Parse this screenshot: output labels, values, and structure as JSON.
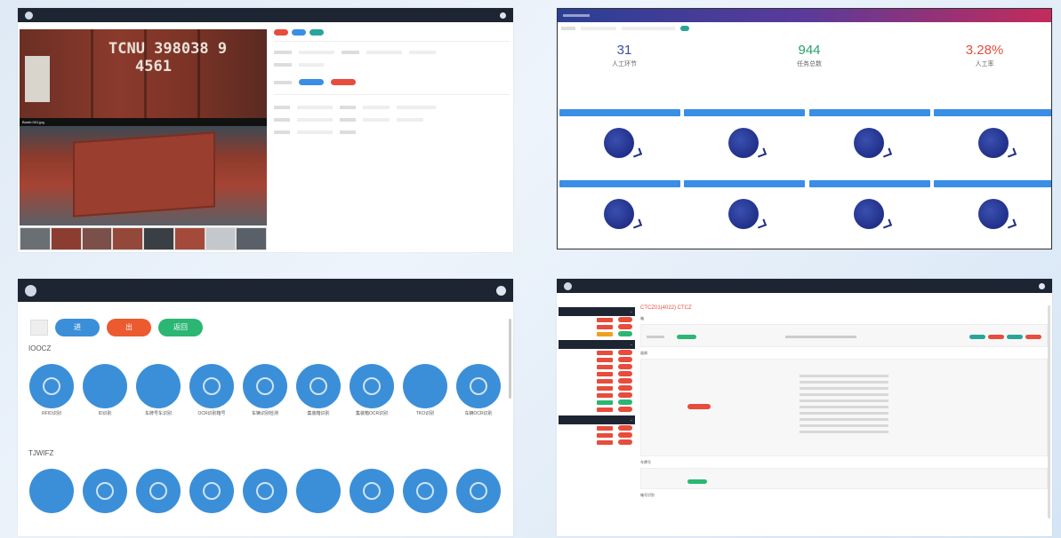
{
  "panel1": {
    "caption": "Bomb 001.jpg",
    "container_code": "TCNU 398038 9",
    "container_code2": "4561",
    "action_buttons": [
      "",
      "",
      ""
    ],
    "thumbs": [
      "#6a6f74",
      "#8a3d30",
      "#7a5048",
      "#93483a",
      "#3a3f45",
      "#a34a3a",
      "#c4c8cc",
      "#5a6068"
    ]
  },
  "panel2": {
    "stats": [
      {
        "value": "31",
        "label": "人工环节",
        "color": "#3b4aa8"
      },
      {
        "value": "944",
        "label": "任务总数",
        "color": "#2aa06a"
      },
      {
        "value": "3.28%",
        "label": "人工率",
        "color": "#e74c3c"
      }
    ]
  },
  "panel3": {
    "tabs": [
      {
        "label": "进",
        "color": "#3b8fd8"
      },
      {
        "label": "出",
        "color": "#ec5a30"
      },
      {
        "label": "返回",
        "color": "#2bb673"
      }
    ],
    "section1": "IOOCZ",
    "section2": "TJWIFZ",
    "row1_labels": [
      "RFID识别",
      "ID识别",
      "车牌号车识别",
      "OCR识别箱号",
      "车辆识别检测",
      "集装箱识别",
      "集装箱OCR识别",
      "TKO识别",
      "车辆OCR识别"
    ],
    "row2_labels": [
      "",
      "",
      "",
      "",
      "",
      "",
      "",
      "",
      ""
    ]
  },
  "panel4": {
    "title": "CTCZ01(4022) CTCZ",
    "label_a": "箱",
    "label_b": "道闸",
    "label_c": "车牌号",
    "label_d": "箱号识别"
  }
}
